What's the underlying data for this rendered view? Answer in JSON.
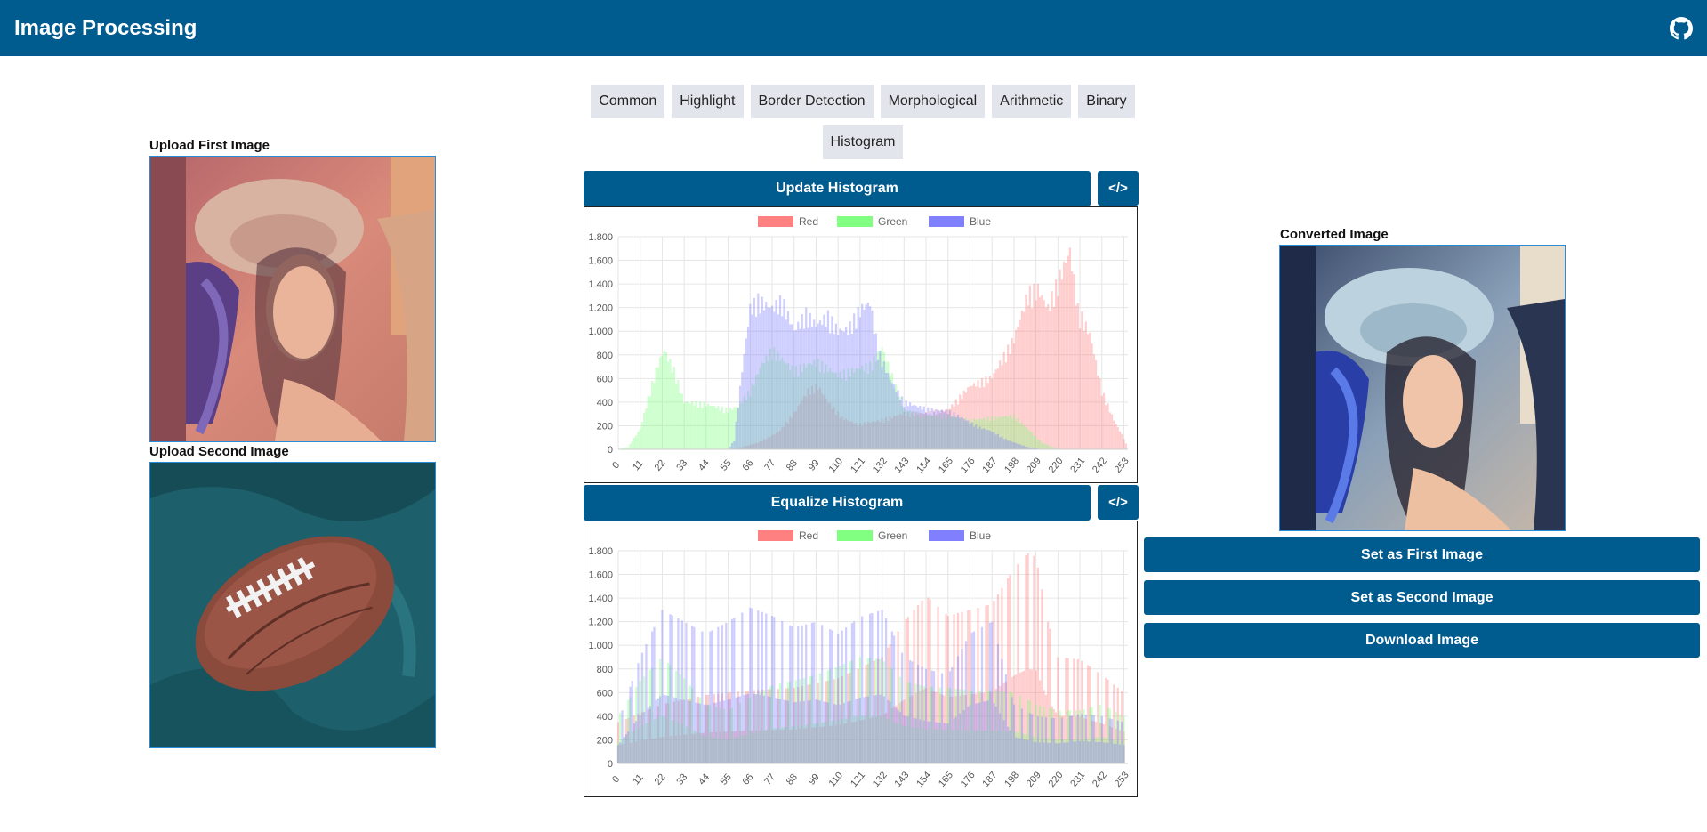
{
  "app": {
    "title": "Image Processing",
    "github_icon": "github-icon"
  },
  "tabs": [
    "Common",
    "Highlight",
    "Border Detection",
    "Morphological",
    "Arithmetic",
    "Binary",
    "Histogram"
  ],
  "first_image": {
    "label": "Upload First Image"
  },
  "second_image": {
    "label": "Upload Second Image"
  },
  "converted_image": {
    "label": "Converted Image"
  },
  "histogram_panel": {
    "update_label": "Update Histogram",
    "equalize_label": "Equalize Histogram",
    "code_label": "</>"
  },
  "actions": {
    "set_first": "Set as First Image",
    "set_second": "Set as Second Image",
    "download": "Download Image"
  },
  "colors": {
    "primary": "#005b8f",
    "red": "#ff8080",
    "green": "#80ff80",
    "blue": "#8080ff"
  },
  "chart_data": [
    {
      "type": "bar",
      "legend": [
        "Red",
        "Green",
        "Blue"
      ],
      "legend_placement": "top-center",
      "x_ticks": [
        0,
        11,
        22,
        33,
        44,
        55,
        66,
        77,
        88,
        99,
        110,
        121,
        132,
        143,
        154,
        165,
        176,
        187,
        198,
        209,
        220,
        231,
        242,
        253
      ],
      "y_ticks": [
        "0",
        "200",
        "400",
        "600",
        "800",
        "1.000",
        "1.200",
        "1.400",
        "1.600",
        "1.800"
      ],
      "ylim": [
        0,
        1800
      ],
      "grid": true,
      "series": [
        {
          "name": "Red",
          "points": [
            [
              0,
              0
            ],
            [
              55,
              0
            ],
            [
              60,
              10
            ],
            [
              70,
              60
            ],
            [
              80,
              150
            ],
            [
              88,
              320
            ],
            [
              95,
              520
            ],
            [
              100,
              560
            ],
            [
              105,
              420
            ],
            [
              112,
              280
            ],
            [
              120,
              220
            ],
            [
              132,
              260
            ],
            [
              143,
              320
            ],
            [
              154,
              320
            ],
            [
              165,
              350
            ],
            [
              176,
              560
            ],
            [
              187,
              640
            ],
            [
              198,
              980
            ],
            [
              205,
              1380
            ],
            [
              210,
              1420
            ],
            [
              215,
              1250
            ],
            [
              222,
              1580
            ],
            [
              226,
              1760
            ],
            [
              230,
              1240
            ],
            [
              236,
              1020
            ],
            [
              242,
              520
            ],
            [
              248,
              260
            ],
            [
              253,
              100
            ],
            [
              255,
              0
            ]
          ]
        },
        {
          "name": "Green",
          "points": [
            [
              0,
              0
            ],
            [
              5,
              20
            ],
            [
              11,
              180
            ],
            [
              16,
              520
            ],
            [
              20,
              760
            ],
            [
              23,
              880
            ],
            [
              28,
              700
            ],
            [
              33,
              420
            ],
            [
              44,
              400
            ],
            [
              55,
              350
            ],
            [
              60,
              380
            ],
            [
              66,
              520
            ],
            [
              72,
              760
            ],
            [
              77,
              880
            ],
            [
              88,
              700
            ],
            [
              99,
              780
            ],
            [
              110,
              660
            ],
            [
              121,
              720
            ],
            [
              126,
              740
            ],
            [
              132,
              900
            ],
            [
              138,
              600
            ],
            [
              143,
              350
            ],
            [
              154,
              300
            ],
            [
              165,
              300
            ],
            [
              176,
              260
            ],
            [
              187,
              280
            ],
            [
              198,
              300
            ],
            [
              205,
              180
            ],
            [
              212,
              60
            ],
            [
              220,
              0
            ],
            [
              255,
              0
            ]
          ]
        },
        {
          "name": "Blue",
          "points": [
            [
              0,
              0
            ],
            [
              55,
              0
            ],
            [
              58,
              80
            ],
            [
              62,
              700
            ],
            [
              66,
              1250
            ],
            [
              70,
              1320
            ],
            [
              77,
              1250
            ],
            [
              82,
              1320
            ],
            [
              88,
              1050
            ],
            [
              94,
              1200
            ],
            [
              99,
              1100
            ],
            [
              105,
              1180
            ],
            [
              110,
              1050
            ],
            [
              115,
              1060
            ],
            [
              121,
              1240
            ],
            [
              126,
              1300
            ],
            [
              130,
              880
            ],
            [
              136,
              620
            ],
            [
              143,
              420
            ],
            [
              150,
              380
            ],
            [
              156,
              350
            ],
            [
              165,
              340
            ],
            [
              172,
              280
            ],
            [
              180,
              200
            ],
            [
              187,
              160
            ],
            [
              195,
              80
            ],
            [
              205,
              20
            ],
            [
              212,
              0
            ],
            [
              255,
              0
            ]
          ]
        }
      ]
    },
    {
      "type": "bar",
      "legend": [
        "Red",
        "Green",
        "Blue"
      ],
      "legend_placement": "top-center",
      "x_ticks": [
        0,
        11,
        22,
        33,
        44,
        55,
        66,
        77,
        88,
        99,
        110,
        121,
        132,
        143,
        154,
        165,
        176,
        187,
        198,
        209,
        220,
        231,
        242,
        253
      ],
      "y_ticks": [
        "0",
        "200",
        "400",
        "600",
        "800",
        "1.000",
        "1.200",
        "1.400",
        "1.600",
        "1.800"
      ],
      "ylim": [
        0,
        1800
      ],
      "grid": true,
      "series": [
        {
          "name": "Red",
          "points": [
            [
              0,
              350
            ],
            [
              22,
              500
            ],
            [
              44,
              580
            ],
            [
              66,
              620
            ],
            [
              88,
              640
            ],
            [
              110,
              720
            ],
            [
              132,
              900
            ],
            [
              143,
              1200
            ],
            [
              154,
              1420
            ],
            [
              165,
              1250
            ],
            [
              176,
              1300
            ],
            [
              187,
              1350
            ],
            [
              198,
              1650
            ],
            [
              205,
              1780
            ],
            [
              209,
              1750
            ],
            [
              215,
              1200
            ],
            [
              220,
              900
            ],
            [
              231,
              880
            ],
            [
              242,
              750
            ],
            [
              253,
              600
            ]
          ]
        },
        {
          "name": "Green",
          "points": [
            [
              0,
              400
            ],
            [
              11,
              700
            ],
            [
              22,
              900
            ],
            [
              33,
              720
            ],
            [
              44,
              500
            ],
            [
              55,
              450
            ],
            [
              66,
              560
            ],
            [
              77,
              660
            ],
            [
              88,
              700
            ],
            [
              99,
              750
            ],
            [
              110,
              820
            ],
            [
              121,
              900
            ],
            [
              132,
              880
            ],
            [
              143,
              700
            ],
            [
              154,
              650
            ],
            [
              165,
              640
            ],
            [
              176,
              620
            ],
            [
              187,
              620
            ],
            [
              198,
              600
            ],
            [
              209,
              500
            ],
            [
              220,
              450
            ],
            [
              231,
              450
            ],
            [
              242,
              500
            ],
            [
              253,
              400
            ]
          ]
        },
        {
          "name": "Blue",
          "points": [
            [
              0,
              350
            ],
            [
              11,
              900
            ],
            [
              22,
              1300
            ],
            [
              33,
              1200
            ],
            [
              44,
              1100
            ],
            [
              55,
              1200
            ],
            [
              66,
              1320
            ],
            [
              77,
              1250
            ],
            [
              88,
              1150
            ],
            [
              99,
              1200
            ],
            [
              110,
              1100
            ],
            [
              121,
              1240
            ],
            [
              132,
              1300
            ],
            [
              143,
              900
            ],
            [
              154,
              800
            ],
            [
              165,
              750
            ],
            [
              176,
              1100
            ],
            [
              187,
              1200
            ],
            [
              198,
              500
            ],
            [
              209,
              400
            ],
            [
              220,
              380
            ],
            [
              231,
              420
            ],
            [
              242,
              400
            ],
            [
              253,
              350
            ]
          ]
        }
      ]
    }
  ]
}
